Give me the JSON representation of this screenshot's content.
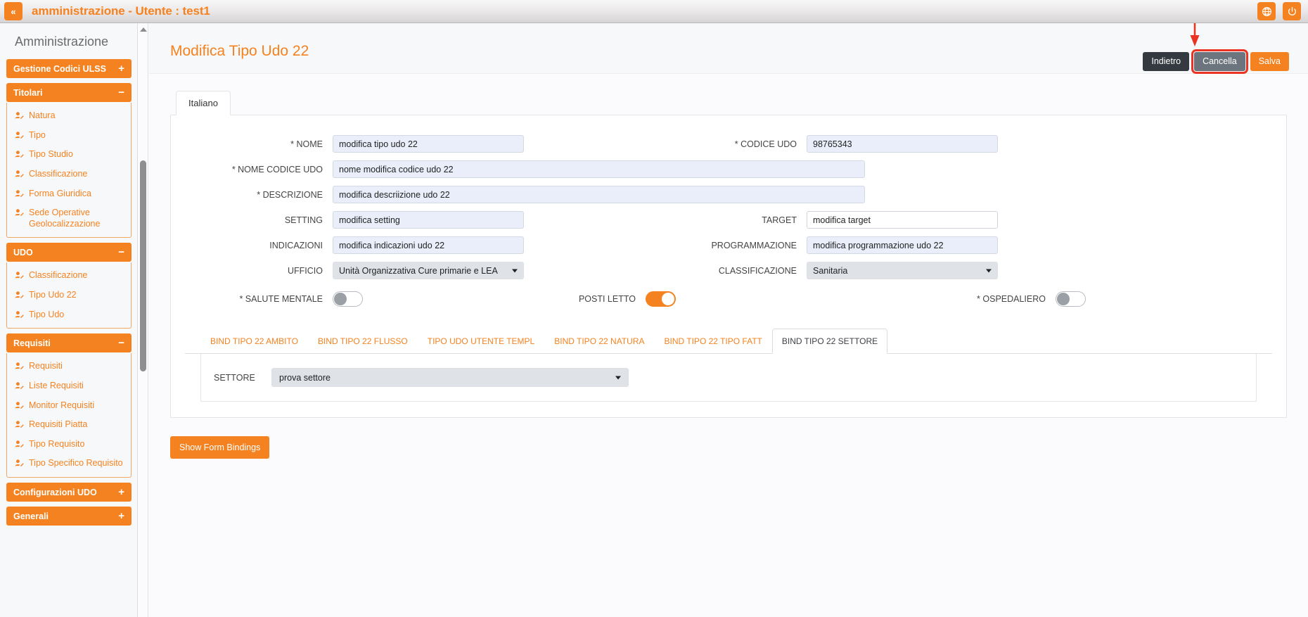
{
  "topbar": {
    "collapse_label": "«",
    "title": "amministrazione - Utente : test1",
    "icons": [
      {
        "name": "globe-icon",
        "glyph": "⊕"
      },
      {
        "name": "power-icon",
        "glyph": "⏻"
      }
    ]
  },
  "sidebar": {
    "heading": "Amministrazione",
    "groups": [
      {
        "label": "Gestione Codici ULSS",
        "sign": "+",
        "expanded": false,
        "items": []
      },
      {
        "label": "Titolari",
        "sign": "−",
        "expanded": true,
        "items": [
          {
            "label": "Natura"
          },
          {
            "label": "Tipo"
          },
          {
            "label": "Tipo Studio"
          },
          {
            "label": "Classificazione"
          },
          {
            "label": "Forma Giuridica"
          },
          {
            "label": "Sede Operative Geolocalizzazione"
          }
        ]
      },
      {
        "label": "UDO",
        "sign": "−",
        "expanded": true,
        "items": [
          {
            "label": "Classificazione"
          },
          {
            "label": "Tipo Udo 22"
          },
          {
            "label": "Tipo Udo"
          }
        ]
      },
      {
        "label": "Requisiti",
        "sign": "−",
        "expanded": true,
        "items": [
          {
            "label": "Requisiti"
          },
          {
            "label": "Liste Requisiti"
          },
          {
            "label": "Monitor Requisiti"
          },
          {
            "label": "Requisiti Piatta"
          },
          {
            "label": "Tipo Requisito"
          },
          {
            "label": "Tipo Specifico Requisito"
          }
        ]
      },
      {
        "label": "Configurazioni UDO",
        "sign": "+",
        "expanded": false,
        "items": []
      },
      {
        "label": "Generali",
        "sign": "+",
        "expanded": false,
        "items": []
      }
    ]
  },
  "page": {
    "title": "Modifica Tipo Udo 22",
    "actions": {
      "back_label": "Indietro",
      "cancel_label": "Cancella",
      "save_label": "Salva"
    },
    "highlight_color": "#ea3323"
  },
  "form": {
    "language_tab": "Italiano",
    "fields": {
      "nome": {
        "label": "* NOME",
        "value": "modifica tipo udo 22",
        "placeholder": ""
      },
      "codice_udo": {
        "label": "* CODICE UDO",
        "value": "98765343",
        "placeholder": ""
      },
      "nome_codice_udo": {
        "label": "* NOME CODICE UDO",
        "value": "nome modifica codice udo 22",
        "placeholder": ""
      },
      "descrizione": {
        "label": "* DESCRIZIONE",
        "value": "modifica descriizione udo 22",
        "placeholder": ""
      },
      "setting": {
        "label": "SETTING",
        "value": "modifica setting",
        "placeholder": ""
      },
      "target": {
        "label": "TARGET",
        "value": "modifica target",
        "placeholder": ""
      },
      "indicazioni": {
        "label": "INDICAZIONI",
        "value": "modifica indicazioni udo 22",
        "placeholder": ""
      },
      "programmazione": {
        "label": "PROGRAMMAZIONE",
        "value": "modifica programmazione udo 22",
        "placeholder": ""
      },
      "ufficio": {
        "label": "UFFICIO",
        "value": "Unità Organizzativa Cure primarie e LEA"
      },
      "classificazione": {
        "label": "CLASSIFICAZIONE",
        "value": "Sanitaria"
      },
      "salute_mentale": {
        "label": "* SALUTE MENTALE",
        "state": "off"
      },
      "posti_letto": {
        "label": "POSTI LETTO",
        "state": "on"
      },
      "ospedaliero": {
        "label": "* OSPEDALIERO",
        "state": "off"
      }
    }
  },
  "bind": {
    "tabs": [
      {
        "label": "BIND TIPO 22 AMBITO",
        "active": false
      },
      {
        "label": "BIND TIPO 22 FLUSSO",
        "active": false
      },
      {
        "label": "TIPO UDO UTENTE TEMPL",
        "active": false
      },
      {
        "label": "BIND TIPO 22 NATURA",
        "active": false
      },
      {
        "label": "BIND TIPO 22 TIPO FATT",
        "active": false
      },
      {
        "label": "BIND TIPO 22 SETTORE",
        "active": true
      }
    ],
    "settore": {
      "label": "SETTORE",
      "value": "prova settore"
    }
  },
  "footer": {
    "show_bindings_label": "Show Form Bindings"
  },
  "theme": {
    "accent": "#f58220",
    "field_fill": "#e9eefa",
    "select_fill": "#dfe3e8",
    "dark_button": "#343a40",
    "grey_button": "#6c757d"
  }
}
